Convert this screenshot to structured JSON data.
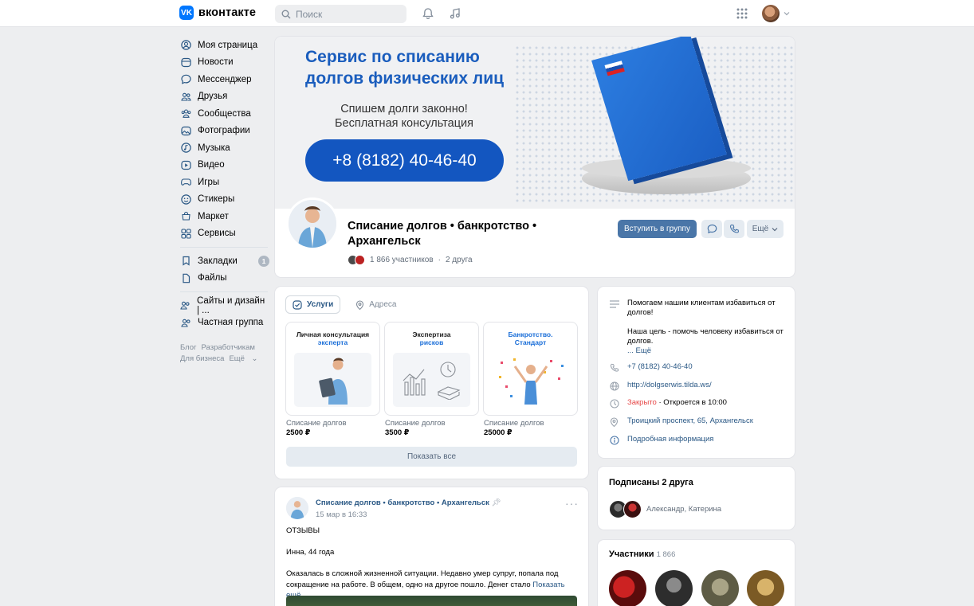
{
  "header": {
    "logo_text": "вконтакте",
    "logo_mark": "VK",
    "search_placeholder": "Поиск",
    "icons": [
      "bell-icon",
      "music-icon",
      "apps-grid-icon",
      "chevron-down-icon"
    ]
  },
  "sidebar": {
    "items": [
      {
        "label": "Моя страница",
        "icon": "user-circle-icon"
      },
      {
        "label": "Новости",
        "icon": "news-icon"
      },
      {
        "label": "Мессенджер",
        "icon": "message-icon"
      },
      {
        "label": "Друзья",
        "icon": "friends-icon"
      },
      {
        "label": "Сообщества",
        "icon": "communities-icon"
      },
      {
        "label": "Фотографии",
        "icon": "photo-icon"
      },
      {
        "label": "Музыка",
        "icon": "music-icon"
      },
      {
        "label": "Видео",
        "icon": "video-icon"
      },
      {
        "label": "Игры",
        "icon": "games-icon"
      },
      {
        "label": "Стикеры",
        "icon": "sticker-icon"
      },
      {
        "label": "Маркет",
        "icon": "market-icon"
      },
      {
        "label": "Сервисы",
        "icon": "services-icon"
      }
    ],
    "items2": [
      {
        "label": "Закладки",
        "icon": "bookmark-icon",
        "badge": "1"
      },
      {
        "label": "Файлы",
        "icon": "file-icon"
      }
    ],
    "items3": [
      {
        "label": "Сайты и дизайн | ...",
        "icon": "group-icon"
      },
      {
        "label": "Частная группа",
        "icon": "group-icon"
      }
    ],
    "footer": [
      "Блог",
      "Разработчикам",
      "Для бизнеса",
      "Ещё"
    ]
  },
  "cover": {
    "title_line1": "Сервис по списанию",
    "title_line2": "долгов физических лиц",
    "sub_line1": "Спишем долги законно!",
    "sub_line2": "Бесплатная консультация",
    "phone": "+8 (8182) 40-46-40"
  },
  "group": {
    "name_line1": "Списание долгов • банкротство •",
    "name_line2": "Архангельск",
    "members": "1 866 участников",
    "friends": "2 друга",
    "join_label": "Вступить в группу",
    "more_label": "Ещё"
  },
  "services": {
    "tab_services": "Услуги",
    "tab_addresses": "Адреса",
    "items": [
      {
        "title_a": "Личная консультация",
        "title_b": "эксперта",
        "caption": "Списание долгов",
        "price": "2500 ₽"
      },
      {
        "title_a": "Экспертиза",
        "title_b": "рисков",
        "caption": "Списание долгов",
        "price": "3500 ₽"
      },
      {
        "title_a": "Банкротство.",
        "title_b": "Стандарт",
        "caption": "Списание долгов",
        "price": "25000 ₽"
      }
    ],
    "show_all": "Показать все"
  },
  "post": {
    "author": "Списание долгов • банкротство • Архангельск",
    "date": "15 мар в 16:33",
    "p1": "ОТЗЫВЫ",
    "p2": "Инна, 44 года",
    "p3": "Оказалась в сложной жизненной ситуации. Недавно умер супруг, попала под сокращение на работе. В общем, одно на другое пошло. Денег стало",
    "more": "Показать ещё"
  },
  "info": {
    "about_1": "Помогаем нашим клиентам избавиться от долгов!",
    "about_2": "Наша цель - помочь человеку избавиться от долгов.",
    "about_more": "... Ещё",
    "phone": "+7 (8182) 40-46-40",
    "site": "http://dolgserwis.tilda.ws/",
    "closed": "Закрыто",
    "opens": "· Откроется в 10:00",
    "address": "Троицкий проспект, 65, Архангельск",
    "details": "Подробная информация"
  },
  "friends": {
    "title": "Подписаны 2 друга",
    "names": "Александр, Катерина"
  },
  "members": {
    "title": "Участники",
    "count": "1 866"
  },
  "colors": {
    "accent": "#4a76a8",
    "link": "#2a5885",
    "cover_blue": "#1356c0",
    "closed_red": "#e64646"
  }
}
